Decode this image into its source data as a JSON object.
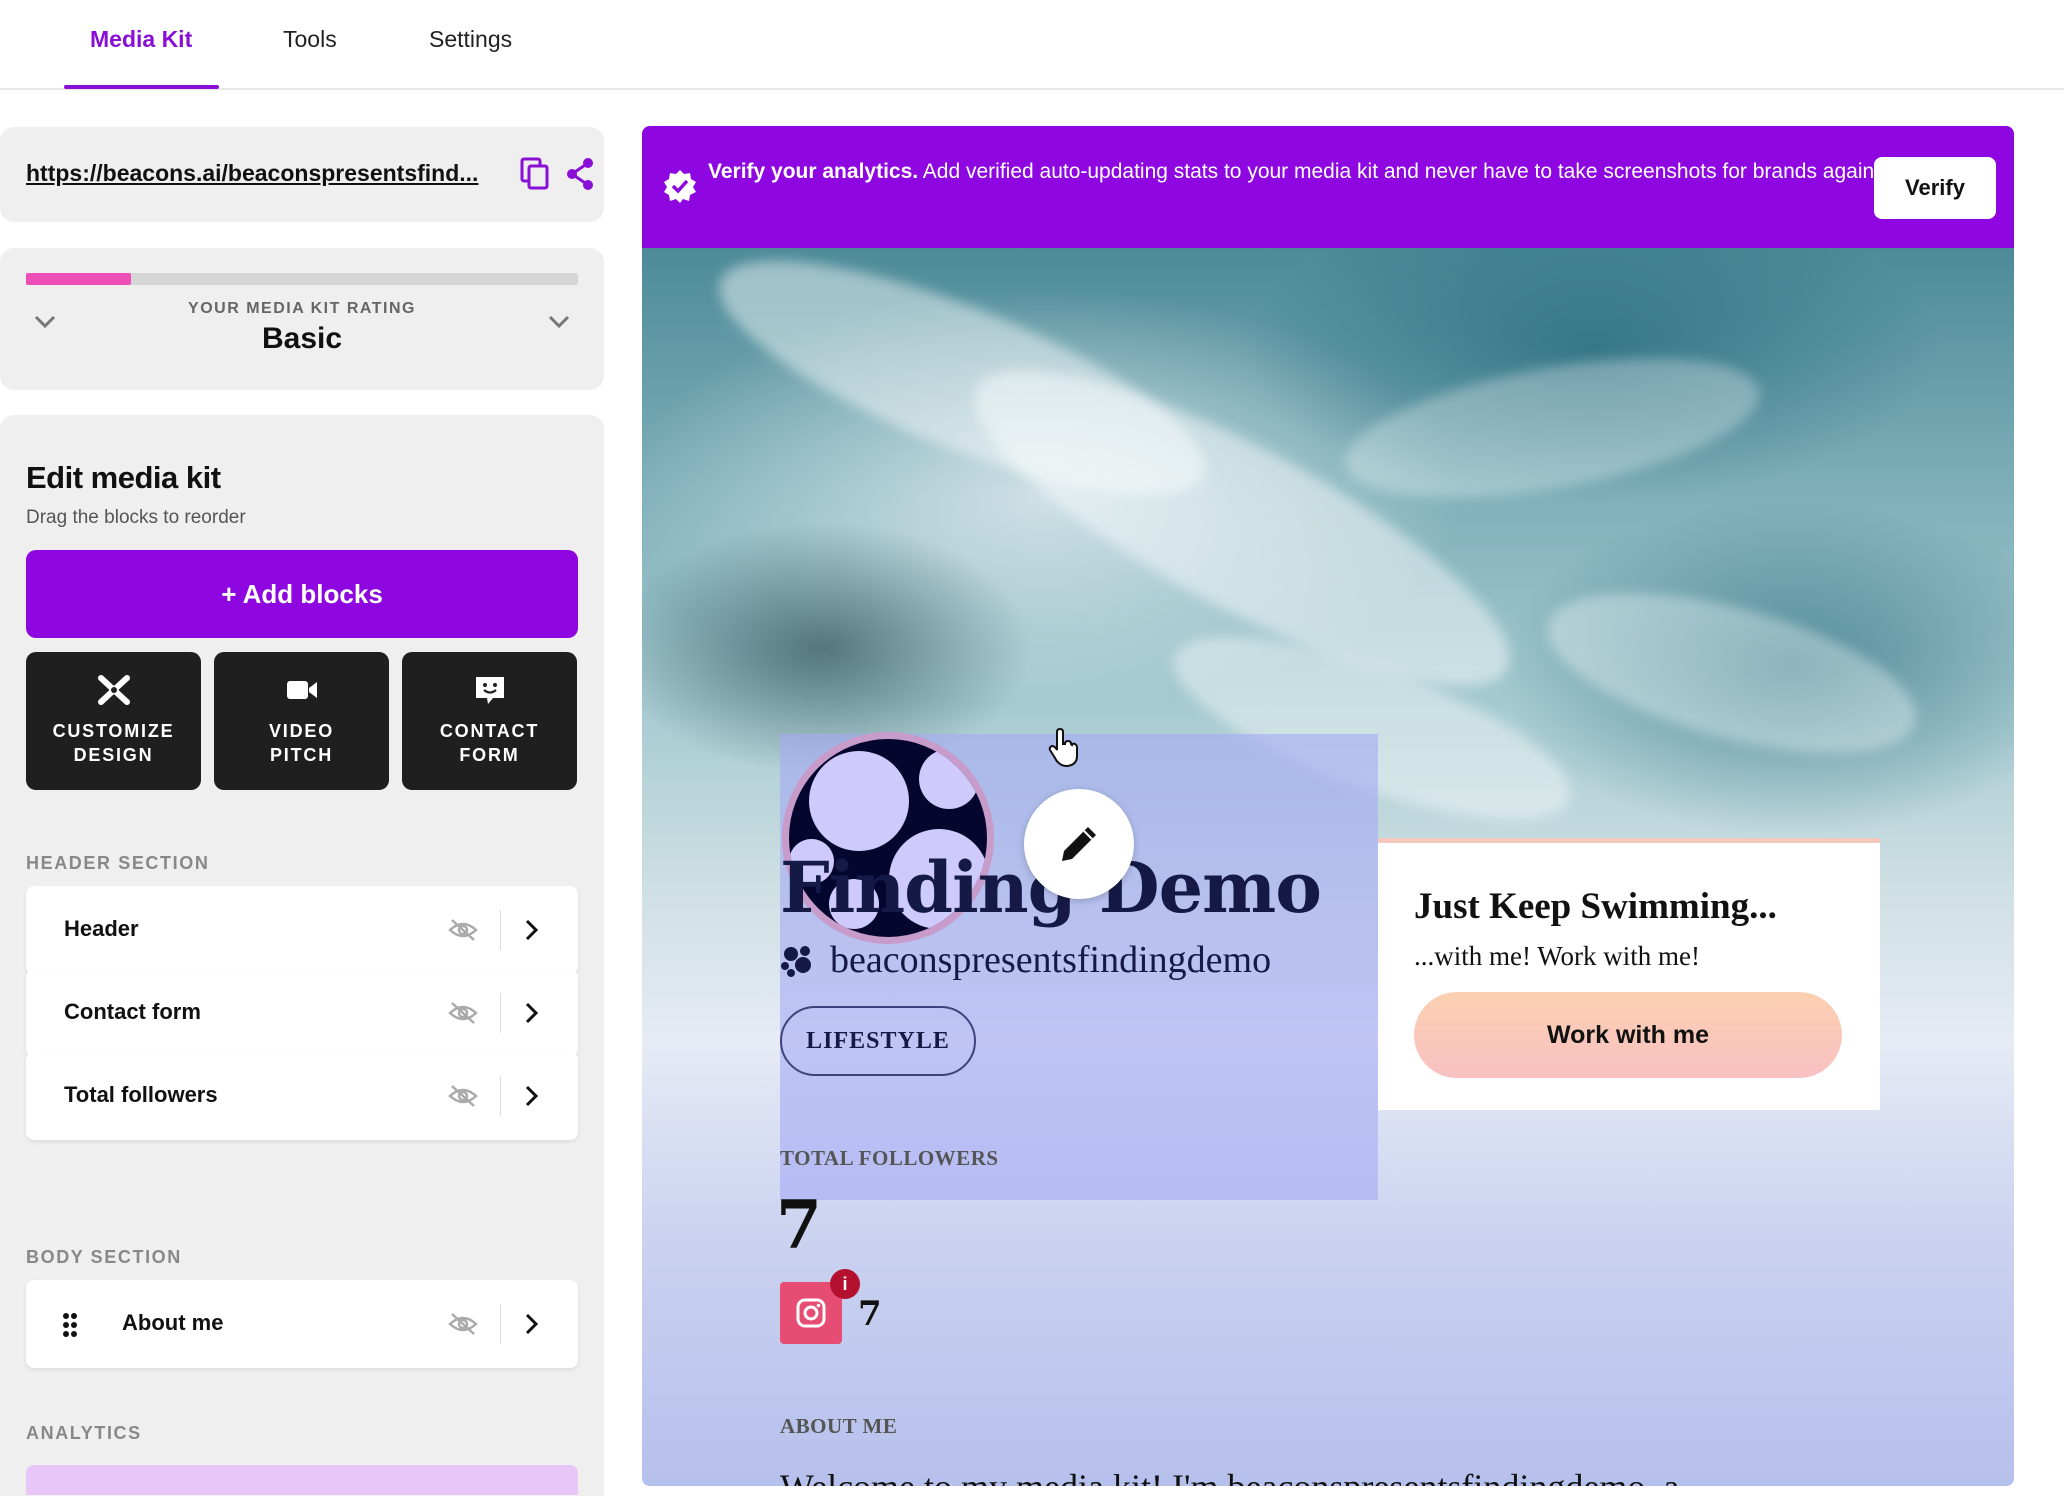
{
  "nav": {
    "tabs": [
      {
        "label": "Media Kit",
        "active": true
      },
      {
        "label": "Tools",
        "active": false
      },
      {
        "label": "Settings",
        "active": false
      }
    ],
    "accent_color": "#8a0fd6"
  },
  "sidebar": {
    "url": "https://beacons.ai/beaconspresentsfindingdemo",
    "url_display": "https://beacons.ai/beaconspresentsfind...",
    "icons": {
      "copy": "copy-icon",
      "share": "share-icon"
    },
    "rating": {
      "label": "YOUR MEDIA KIT RATING",
      "value": "Basic",
      "progress_fraction": 0.19,
      "progress_color": "#ee4fb6"
    },
    "edit": {
      "title": "Edit media kit",
      "subtitle": "Drag the blocks to reorder",
      "add_button": "+ Add blocks",
      "add_button_color": "#8e06e0",
      "tiles": [
        {
          "label": "CUSTOMIZE\nDESIGN",
          "icon": "design-tools-icon"
        },
        {
          "label": "VIDEO\nPITCH",
          "icon": "video-camera-icon"
        },
        {
          "label": "CONTACT\nFORM",
          "icon": "chat-smile-icon"
        }
      ]
    },
    "header_section": {
      "label": "HEADER SECTION",
      "rows": [
        {
          "label": "Header"
        },
        {
          "label": "Contact form"
        },
        {
          "label": "Total followers"
        }
      ]
    },
    "body_section": {
      "label": "BODY SECTION",
      "rows": [
        {
          "label": "About me"
        }
      ]
    },
    "analytics_label": "ANALYTICS"
  },
  "preview": {
    "banner": {
      "bold": "Verify your analytics.",
      "text": " Add verified auto-updating stats to your media kit and never have to take screenshots for brands again!",
      "button": "Verify",
      "color": "#8e06e0"
    },
    "profile": {
      "name": "Finding Demo",
      "handle": "beaconspresentsfindingdemo",
      "tag": "LIFESTYLE"
    },
    "cta": {
      "title": "Just Keep Swimming...",
      "subtitle": "...with me! Work with me!",
      "button": "Work with me"
    },
    "followers": {
      "label": "TOTAL FOLLOWERS",
      "total": "7",
      "instagram_count": "7",
      "badge": "i"
    },
    "about": {
      "label": "ABOUT ME",
      "text": "Welcome to my media kit! I'm beaconspresentsfindingdemo, a"
    }
  }
}
